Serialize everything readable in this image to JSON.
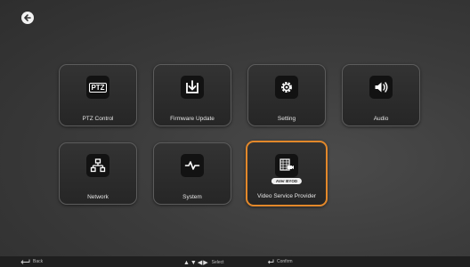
{
  "tiles": [
    {
      "label": "PTZ Control",
      "icon_text": "PTZ"
    },
    {
      "label": "Firmware Update"
    },
    {
      "label": "Setting"
    },
    {
      "label": "Audio"
    },
    {
      "label": "Network"
    },
    {
      "label": "System"
    },
    {
      "label": "Video Service Provider",
      "badge": "AVer BYOD"
    }
  ],
  "bottom_bar": {
    "back_label": "Back",
    "select_label": "Select",
    "confirm_label": "Confirm"
  },
  "colors": {
    "selected_border": "#e3882a",
    "background": "#3c3c3c"
  }
}
